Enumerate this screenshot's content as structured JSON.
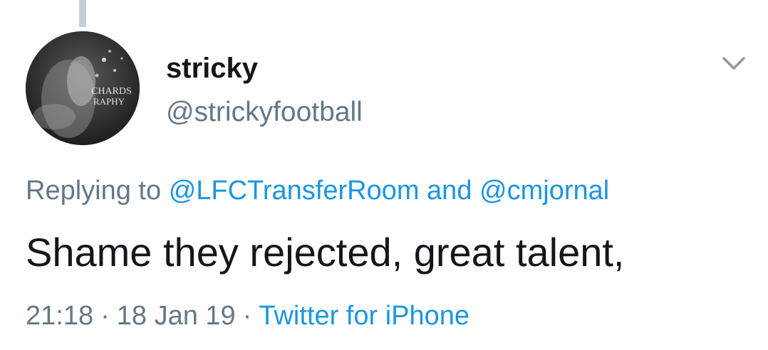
{
  "tweet": {
    "author": {
      "display_name": "stricky",
      "handle": "@strickyfootball",
      "avatar_text_1": "CHARDS",
      "avatar_text_2": "RAPHY"
    },
    "reply": {
      "prefix": "Replying to",
      "mention_1": "@LFCTransferRoom",
      "conjunction": "and",
      "mention_2": "@cmjornal"
    },
    "text": "Shame they rejected, great talent,",
    "meta": {
      "time": "21:18",
      "separator": "·",
      "date": "18 Jan 19",
      "source": "Twitter for iPhone"
    },
    "menu_icon": "chevron-down-icon"
  },
  "colors": {
    "link": "#1b95e0",
    "secondary_text": "#657786",
    "primary_text": "#14171a",
    "thread_line": "#c4cfd6"
  }
}
